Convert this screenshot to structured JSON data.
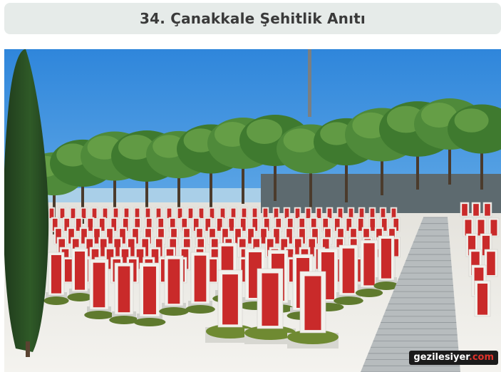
{
  "heading": {
    "title": "34. Çanakkale Şehitlik Anıtı"
  },
  "photo": {
    "watermark_brand": "gezilesiyer",
    "watermark_tld": ".com"
  },
  "colors": {
    "title_bar": "#e6ebe9",
    "title_text": "#3a3a3a",
    "sky": "#4da5e6",
    "headstone_red": "#c92a2a",
    "pine_green": "#4f8a3a",
    "watermark_accent": "#e0322b"
  }
}
